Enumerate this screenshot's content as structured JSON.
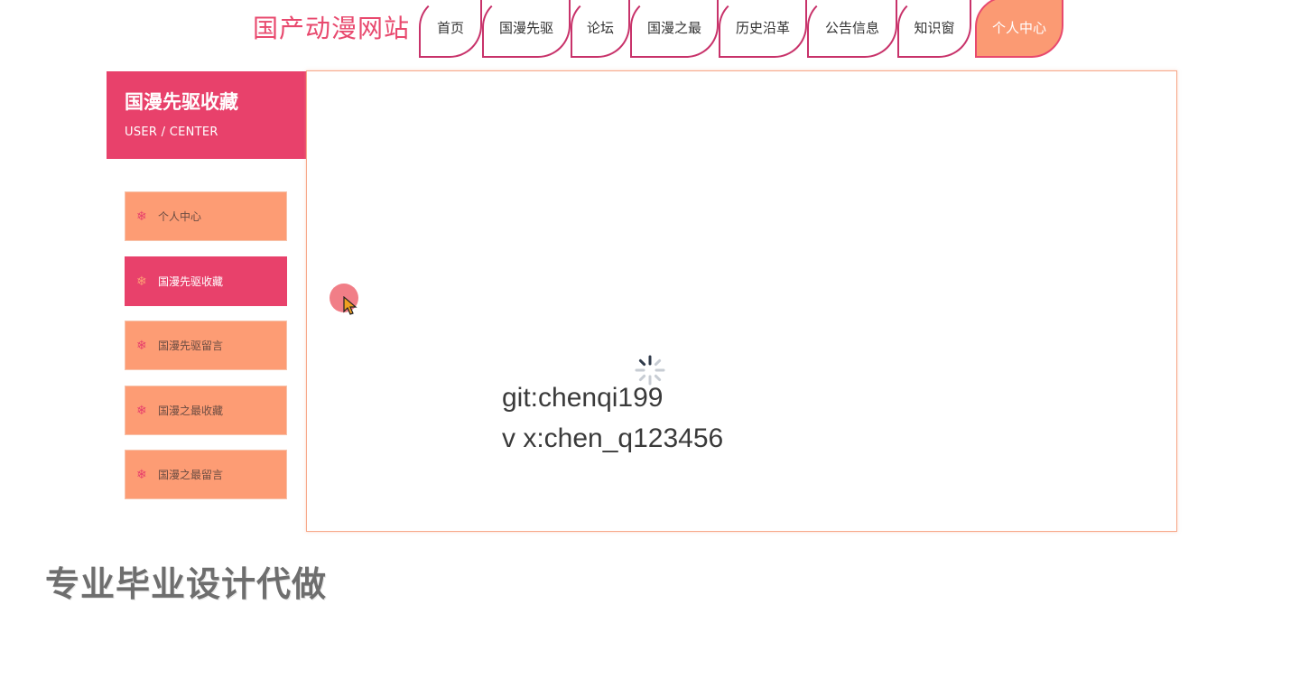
{
  "header": {
    "site_title": "国产动漫网站",
    "nav": [
      {
        "label": "首页"
      },
      {
        "label": "国漫先驱"
      },
      {
        "label": "论坛"
      },
      {
        "label": "国漫之最"
      },
      {
        "label": "历史沿革"
      },
      {
        "label": "公告信息"
      },
      {
        "label": "知识窗"
      },
      {
        "label": "个人中心",
        "active": true
      }
    ]
  },
  "sidebar": {
    "title": "国漫先驱收藏",
    "subtitle": "USER / CENTER",
    "items": [
      {
        "label": "个人中心",
        "icon": "snowflake-icon"
      },
      {
        "label": "国漫先驱收藏",
        "icon": "snowflake-icon",
        "active": true
      },
      {
        "label": "国漫先驱留言",
        "icon": "snowflake-icon"
      },
      {
        "label": "国漫之最收藏",
        "icon": "snowflake-icon"
      },
      {
        "label": "国漫之最留言",
        "icon": "snowflake-icon"
      }
    ]
  },
  "content": {
    "line1": "git:chenqi199",
    "line2": "v x:chen_q123456"
  },
  "watermark": "专业毕业设计代做",
  "colors": {
    "accent": "#e8416b",
    "secondary": "#fd9c74"
  }
}
